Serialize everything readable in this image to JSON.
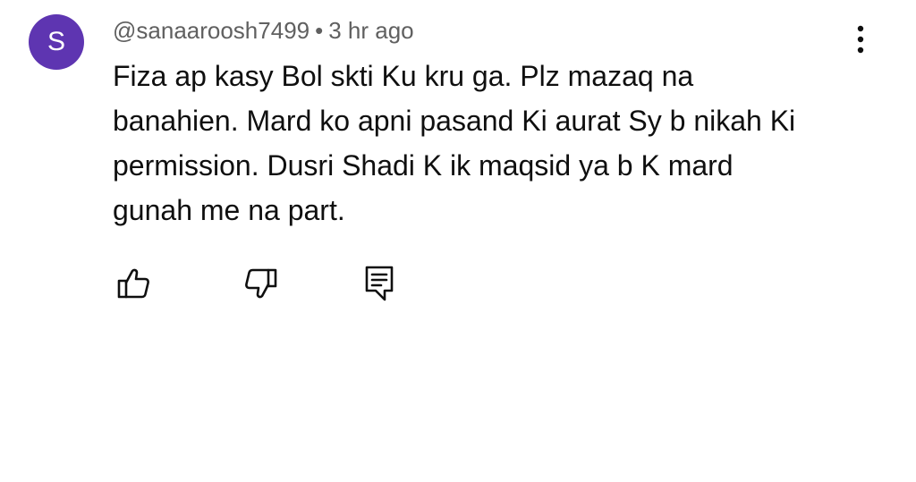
{
  "comment": {
    "avatar_letter": "S",
    "avatar_color": "#5e35b1",
    "author": "@sanaaroosh7499",
    "separator": "•",
    "timestamp": "3 hr ago",
    "text": "Fiza ap kasy Bol skti Ku kru ga. Plz mazaq na\nbanahien. Mard ko apni pasand Ki aurat Sy b nikah Ki\npermission. Dusri Shadi K ik maqsid ya b K mard\ngunah me na part."
  },
  "icons": {
    "more": "more-vert-icon",
    "like": "thumbs-up-icon",
    "dislike": "thumbs-down-icon",
    "reply": "reply-comment-icon"
  }
}
